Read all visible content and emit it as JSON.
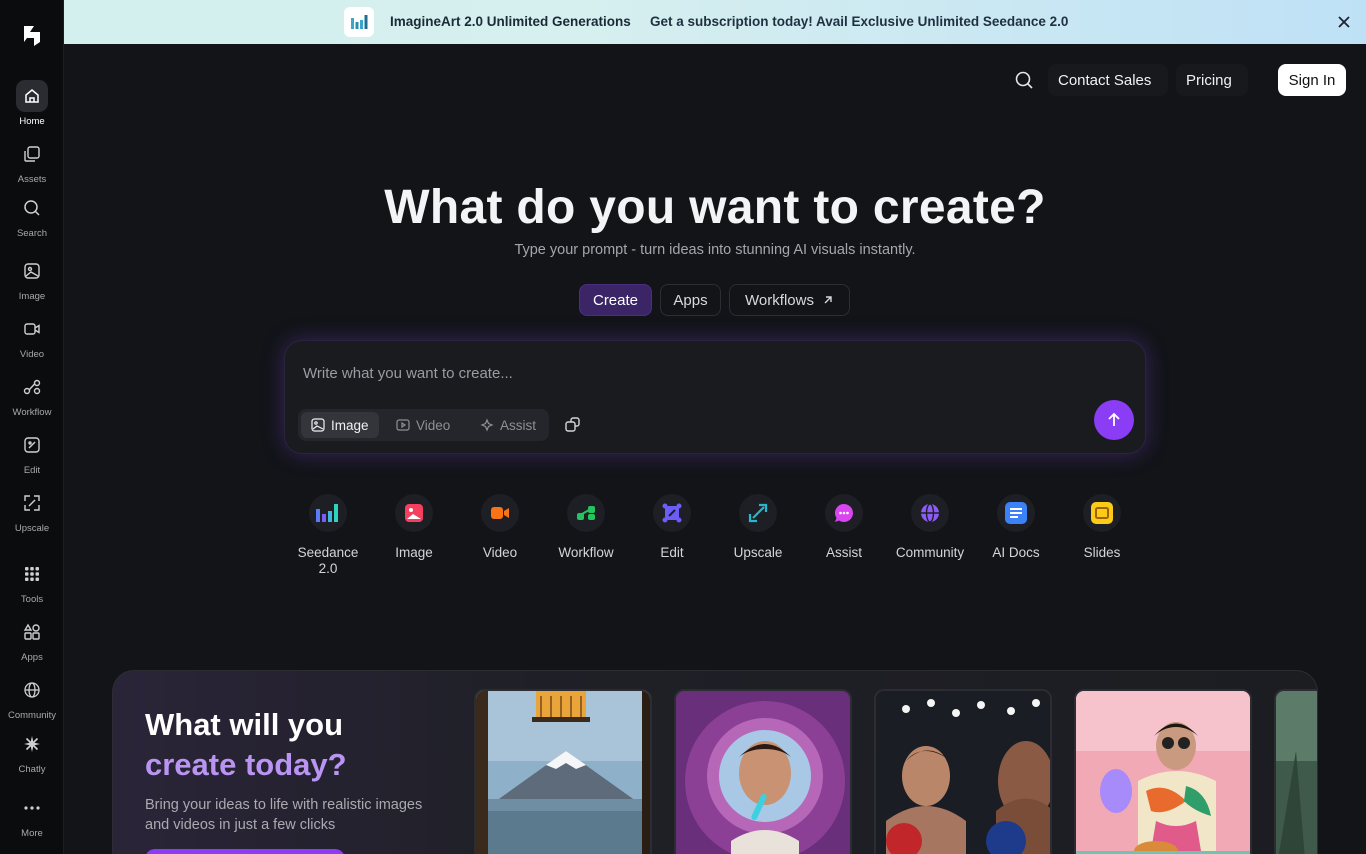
{
  "banner": {
    "title": "ImagineArt 2.0 Unlimited Generations",
    "text": "Get a subscription today! Avail Exclusive Unlimited Seedance 2.0"
  },
  "sidebar": {
    "items": [
      {
        "label": "Home",
        "icon": "home-icon"
      },
      {
        "label": "Assets",
        "icon": "assets-icon"
      },
      {
        "label": "Search",
        "icon": "search-icon"
      },
      {
        "label": "Image",
        "icon": "image-icon"
      },
      {
        "label": "Video",
        "icon": "video-icon"
      },
      {
        "label": "Workflow",
        "icon": "workflow-icon"
      },
      {
        "label": "Edit",
        "icon": "edit-icon"
      },
      {
        "label": "Upscale",
        "icon": "upscale-icon"
      },
      {
        "label": "Tools",
        "icon": "grid-icon"
      },
      {
        "label": "Apps",
        "icon": "apps-icon"
      },
      {
        "label": "Community",
        "icon": "globe-icon"
      },
      {
        "label": "Chatly",
        "icon": "chatly-icon"
      },
      {
        "label": "More",
        "icon": "more-icon"
      }
    ]
  },
  "topnav": {
    "contact": "Contact Sales",
    "pricing": "Pricing",
    "signin": "Sign In"
  },
  "hero": {
    "title": "What do you want to create?",
    "subtitle": "Type your prompt - turn ideas into stunning AI visuals instantly.",
    "tabs": [
      "Create",
      "Apps",
      "Workflows"
    ]
  },
  "prompt": {
    "placeholder": "Write what you want to create...",
    "types": [
      "Image",
      "Video",
      "Assist"
    ]
  },
  "tools": [
    {
      "label": "Seedance 2.0",
      "color": "#3b82f6"
    },
    {
      "label": "Image",
      "color": "#f43f5e"
    },
    {
      "label": "Video",
      "color": "#f97316"
    },
    {
      "label": "Workflow",
      "color": "#22c55e"
    },
    {
      "label": "Edit",
      "color": "#6d5cf6"
    },
    {
      "label": "Upscale",
      "color": "#22b8cf"
    },
    {
      "label": "Assist",
      "color": "#d946ef"
    },
    {
      "label": "Community",
      "color": "#8b5cf6"
    },
    {
      "label": "AI Docs",
      "color": "#3b82f6"
    },
    {
      "label": "Slides",
      "color": "#facc15"
    }
  ],
  "promo": {
    "title_line1": "What will you",
    "title_line2": "create today?",
    "subtitle": "Bring your ideas to life with realistic images and videos in just a few clicks"
  }
}
